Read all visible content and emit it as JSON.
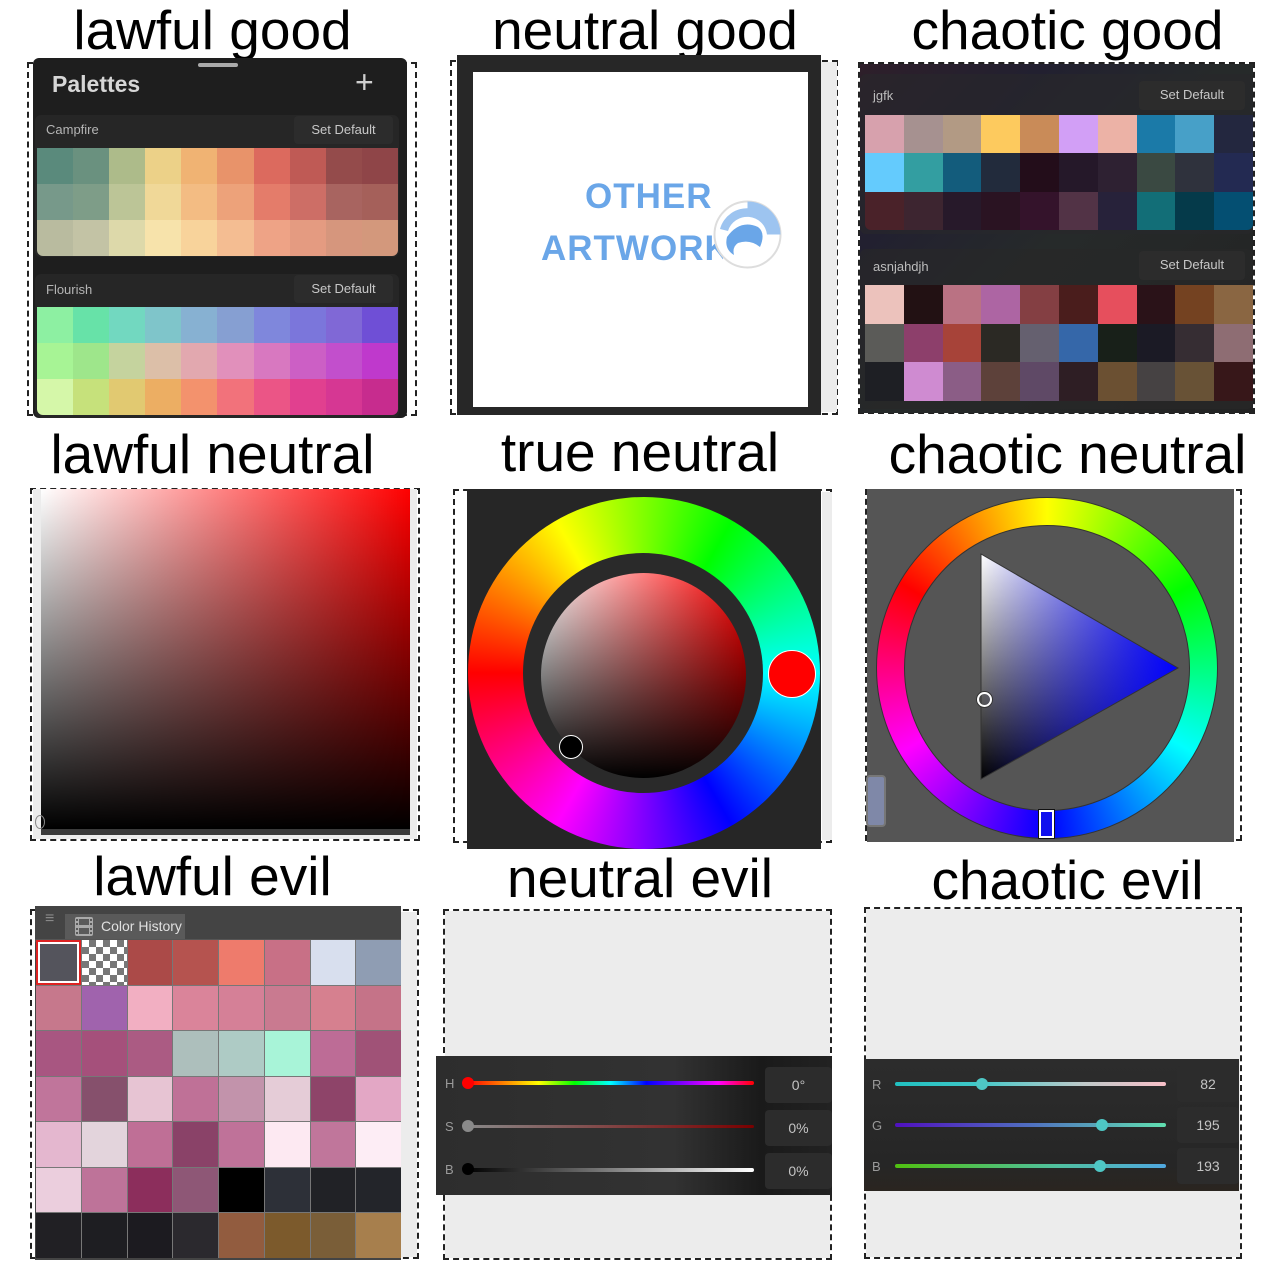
{
  "titles": {
    "lawful_good": "lawful good",
    "neutral_good": "neutral good",
    "chaotic_good": "chaotic good",
    "lawful_neutral": "lawful neutral",
    "true_neutral": "true neutral",
    "chaotic_neutral": "chaotic neutral",
    "lawful_evil": "lawful evil",
    "neutral_evil": "neutral evil",
    "chaotic_evil": "chaotic evil"
  },
  "lawful_good": {
    "header": "Palettes",
    "add_icon": "+",
    "palettes": [
      {
        "name": "Campfire",
        "button": "Set Default",
        "colors": [
          "#5a8a7c",
          "#6a917f",
          "#adbb8a",
          "#ecd188",
          "#f0b373",
          "#e8936a",
          "#dc6a5e",
          "#bf5a55",
          "#944b4b",
          "#8f4548",
          "#77998a",
          "#7e9d88",
          "#bcc597",
          "#f0d898",
          "#f3bc83",
          "#eda27a",
          "#e47c6a",
          "#cd6e66",
          "#a86460",
          "#a5605a",
          "#b9bb9f",
          "#c3c3a5",
          "#ddd9aa",
          "#f7e3ab",
          "#f8d39b",
          "#f4bd92",
          "#eea386",
          "#e49b81",
          "#d6967d",
          "#d3987c"
        ]
      },
      {
        "name": "Flourish",
        "button": "Set Default",
        "colors": [
          "#8df0a2",
          "#67e2a8",
          "#72d8c0",
          "#7fc5ca",
          "#87b1d2",
          "#869fd2",
          "#7f87dc",
          "#7b76db",
          "#8068d6",
          "#6f4fd6",
          "#a7f495",
          "#9ee68b",
          "#c5d39e",
          "#dcbfa8",
          "#e2a8af",
          "#e190bb",
          "#d878c0",
          "#cc5fc5",
          "#c24fcc",
          "#bf39cc",
          "#d5f7a9",
          "#c6e17b",
          "#e1c971",
          "#ecae63",
          "#f3926d",
          "#f2727b",
          "#eb5586",
          "#e1408f",
          "#d63793",
          "#c72c8e"
        ]
      }
    ]
  },
  "neutral_good": {
    "artwork_line1": "OTHER",
    "artwork_line2": "ARTWORK",
    "accent_color": "#6aa6e8"
  },
  "chaotic_good": {
    "palettes": [
      {
        "name": "jgfk",
        "button": "Set Default",
        "colors": [
          "#d7a1ad",
          "#a69190",
          "#b29a84",
          "#fdca5e",
          "#c98b58",
          "#d29ff6",
          "#ecb2a6",
          "#1b7aa8",
          "#47a0c8",
          "#23273f",
          "#64cbfd",
          "#339ea1",
          "#135c7c",
          "#222b3c",
          "#230d1a",
          "#251829",
          "#2e2132",
          "#3a4942",
          "#2f323d",
          "#232a52",
          "#4a2229",
          "#3d2530",
          "#27192a",
          "#2a1322",
          "#34132b",
          "#523346",
          "#27223a",
          "#126e77",
          "#053a4a",
          "#044f72"
        ]
      },
      {
        "name": "asnjahdjh",
        "button": "Set Default",
        "colors": [
          "#ecc2bc",
          "#221113",
          "#ba7283",
          "#ad65a3",
          "#843f43",
          "#4a1d1c",
          "#e64f5d",
          "#2a1218",
          "#744221",
          "#8a6642",
          "#5b5b58",
          "#8d3f6b",
          "#a74339",
          "#2b2924",
          "#65606f",
          "#3567a9",
          "#182019",
          "#1b1a25",
          "#362d33",
          "#8e6d73",
          "#1e1f24",
          "#cf8bd1",
          "#8b5d86",
          "#5d413a",
          "#5f4966",
          "#2e1e24",
          "#6b5032",
          "#464243",
          "#685236",
          "#371719"
        ]
      }
    ]
  },
  "lawful_neutral": {
    "hue_color": "#ff0000"
  },
  "true_neutral": {
    "selected_hue": "#ff0000",
    "selected_color": "#000000"
  },
  "chaotic_neutral": {
    "hue_color": "#0000ff"
  },
  "lawful_evil": {
    "tab_label": "Color History",
    "menu_icon": "≡",
    "colors": [
      "#54545c",
      "checker",
      "#ab4a48",
      "#b5534f",
      "#ee7b6c",
      "#c87086",
      "#d8dfee",
      "#8f9db3",
      "#c6788c",
      "#a063ad",
      "#f2afc2",
      "#da849a",
      "#d58097",
      "#c97a90",
      "#d6808f",
      "#c57388",
      "#a85681",
      "#a5507b",
      "#ab5b83",
      "#adbfbc",
      "#aecbc5",
      "#a8f4d8",
      "#bd6c96",
      "#a05277",
      "#c0759b",
      "#86506c",
      "#e7c4d3",
      "#bf7197",
      "#c293ab",
      "#e5ccd7",
      "#8e4469",
      "#e3a7c5",
      "#e4b7cf",
      "#e3d4dc",
      "#bf6f96",
      "#8a4268",
      "#bf7299",
      "#fde9f2",
      "#c0769b",
      "#fdedf5",
      "#ebcedd",
      "#be7399",
      "#8c2e5c",
      "#8e5776",
      "#000000",
      "#2d3038",
      "#212226",
      "#23252a",
      "#212024",
      "#1e1e22",
      "#1c1b20",
      "#2b292e",
      "#925c3f",
      "#7c5a2c",
      "#7a5e38",
      "#a77f4d"
    ]
  },
  "neutral_evil": {
    "sliders": [
      {
        "label": "H",
        "value": "0°"
      },
      {
        "label": "S",
        "value": "0%"
      },
      {
        "label": "B",
        "value": "0%"
      }
    ],
    "hue_deg": 0,
    "saturation_pct": 0,
    "brightness_pct": 0
  },
  "chaotic_evil": {
    "sliders": [
      {
        "label": "R",
        "value": "82",
        "fraction": 0.32
      },
      {
        "label": "G",
        "value": "195",
        "fraction": 0.765
      },
      {
        "label": "B",
        "value": "193",
        "fraction": 0.757
      }
    ]
  }
}
